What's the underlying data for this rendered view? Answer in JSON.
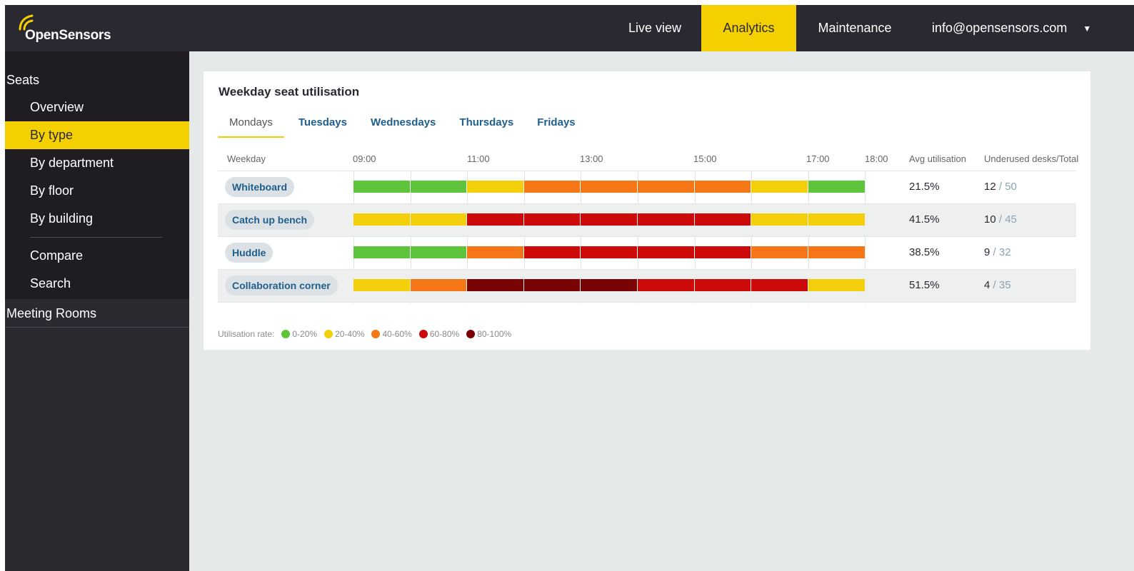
{
  "app": {
    "brand": "OpenSensors"
  },
  "nav": {
    "live": "Live view",
    "analytics": "Analytics",
    "maintenance": "Maintenance",
    "user": "info@opensensors.com"
  },
  "sidebar": {
    "seats": "Seats",
    "items": [
      "Overview",
      "By type",
      "By department",
      "By floor",
      "By building"
    ],
    "items2": [
      "Compare",
      "Search"
    ],
    "active": "By type",
    "rooms": "Meeting Rooms"
  },
  "card": {
    "title": "Weekday seat utilisation",
    "tabs": [
      "Mondays",
      "Tuesdays",
      "Wednesdays",
      "Thursdays",
      "Fridays"
    ],
    "active_tab": "Mondays",
    "headers": {
      "weekday": "Weekday",
      "times": [
        "09:00",
        "11:00",
        "13:00",
        "15:00",
        "17:00",
        "18:00"
      ],
      "avg": "Avg utilisation",
      "under": "Underused desks/Total"
    }
  },
  "colors": {
    "0-20": "#5ec43b",
    "20-40": "#f2cf0a",
    "40-60": "#f57617",
    "60-80": "#cc0a0a",
    "80-100": "#7a0404",
    "accent": "#f5d000"
  },
  "chart_data": {
    "type": "heatmap",
    "title": "Weekday seat utilisation",
    "slots": 9,
    "rows": [
      {
        "label": "Whiteboard",
        "bands": [
          "0-20",
          "0-20",
          "20-40",
          "40-60",
          "40-60",
          "40-60",
          "40-60",
          "20-40",
          "0-20"
        ],
        "avg": "21.5%",
        "underused": "12",
        "total": "50"
      },
      {
        "label": "Catch up bench",
        "bands": [
          "20-40",
          "20-40",
          "60-80",
          "60-80",
          "60-80",
          "60-80",
          "60-80",
          "20-40",
          "20-40"
        ],
        "avg": "41.5%",
        "underused": "10",
        "total": "45"
      },
      {
        "label": "Huddle",
        "bands": [
          "0-20",
          "0-20",
          "40-60",
          "60-80",
          "60-80",
          "60-80",
          "60-80",
          "40-60",
          "40-60"
        ],
        "avg": "38.5%",
        "underused": "9",
        "total": "32"
      },
      {
        "label": "Collaboration corner",
        "bands": [
          "20-40",
          "40-60",
          "80-100",
          "80-100",
          "80-100",
          "60-80",
          "60-80",
          "60-80",
          "20-40"
        ],
        "avg": "51.5%",
        "underused": "4",
        "total": "35"
      }
    ],
    "legend": {
      "label": "Utilisation rate:",
      "items": [
        "0-20%",
        "20-40%",
        "40-60%",
        "60-80%",
        "80-100%"
      ],
      "keys": [
        "0-20",
        "20-40",
        "40-60",
        "60-80",
        "80-100"
      ]
    }
  }
}
